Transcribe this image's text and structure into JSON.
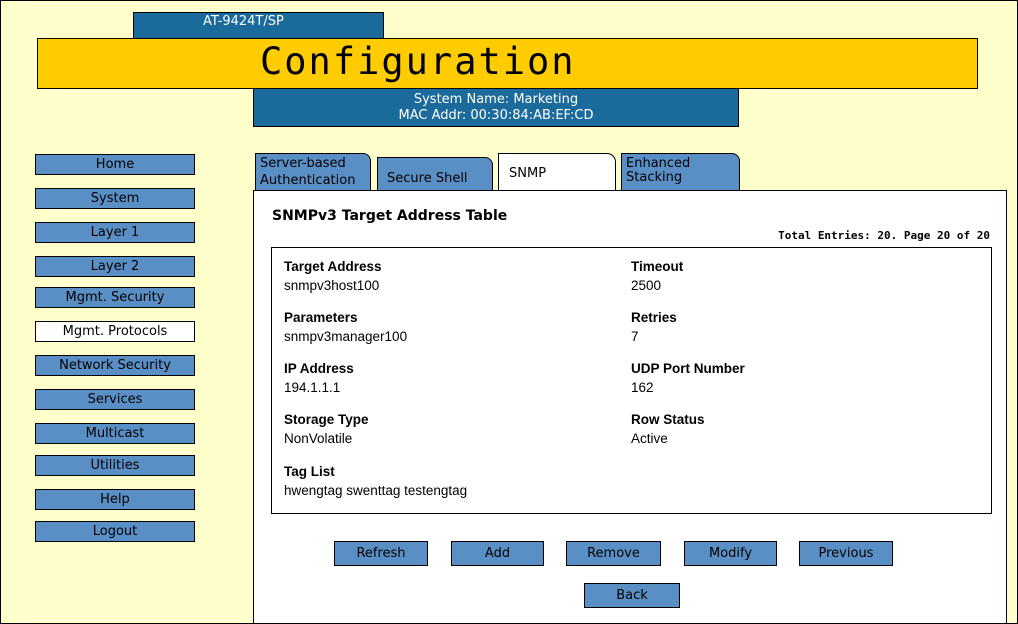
{
  "device": {
    "model": "AT-9424T/SP"
  },
  "banner": {
    "title": "Configuration"
  },
  "system": {
    "name_line": "System Name: Marketing",
    "mac_line": "MAC Addr: 00:30:84:AB:EF:CD"
  },
  "sidebar": {
    "items": [
      {
        "label": "Home"
      },
      {
        "label": "System"
      },
      {
        "label": "Layer 1"
      },
      {
        "label": "Layer 2"
      },
      {
        "label": "Mgmt. Security"
      },
      {
        "label": "Mgmt. Protocols",
        "selected": true
      },
      {
        "label": "Network Security"
      },
      {
        "label": "Services"
      },
      {
        "label": "Multicast"
      },
      {
        "label": "Utilities"
      },
      {
        "label": "Help"
      },
      {
        "label": "Logout"
      }
    ]
  },
  "tabs": [
    {
      "line1": "Server-based",
      "line2": "Authentication"
    },
    {
      "line1": "Secure Shell",
      "line2": ""
    },
    {
      "line1": "SNMP",
      "line2": "",
      "active": true
    },
    {
      "line1": "Enhanced",
      "line2": "Stacking"
    }
  ],
  "panel": {
    "title": "SNMPv3 Target Address Table",
    "total_entries": "Total Entries: 20. Page 20 of 20"
  },
  "fields": {
    "target_address": {
      "label": "Target Address",
      "value": "snmpv3host100"
    },
    "timeout": {
      "label": "Timeout",
      "value": "2500"
    },
    "parameters": {
      "label": "Parameters",
      "value": "snmpv3manager100"
    },
    "retries": {
      "label": "Retries",
      "value": "7"
    },
    "ip_address": {
      "label": "IP Address",
      "value": "194.1.1.1"
    },
    "udp_port": {
      "label": "UDP Port Number",
      "value": "162"
    },
    "storage_type": {
      "label": "Storage Type",
      "value": "NonVolatile"
    },
    "row_status": {
      "label": "Row Status",
      "value": "Active"
    },
    "tag_list": {
      "label": "Tag List",
      "value": "hwengtag swenttag testengtag"
    }
  },
  "actions": {
    "refresh": "Refresh",
    "add": "Add",
    "remove": "Remove",
    "modify": "Modify",
    "previous": "Previous",
    "back": "Back"
  },
  "colors": {
    "background": "#ffffcc",
    "banner": "#ffcc00",
    "header_blue": "#1b6a9c",
    "button_blue": "#5a8fc6"
  }
}
